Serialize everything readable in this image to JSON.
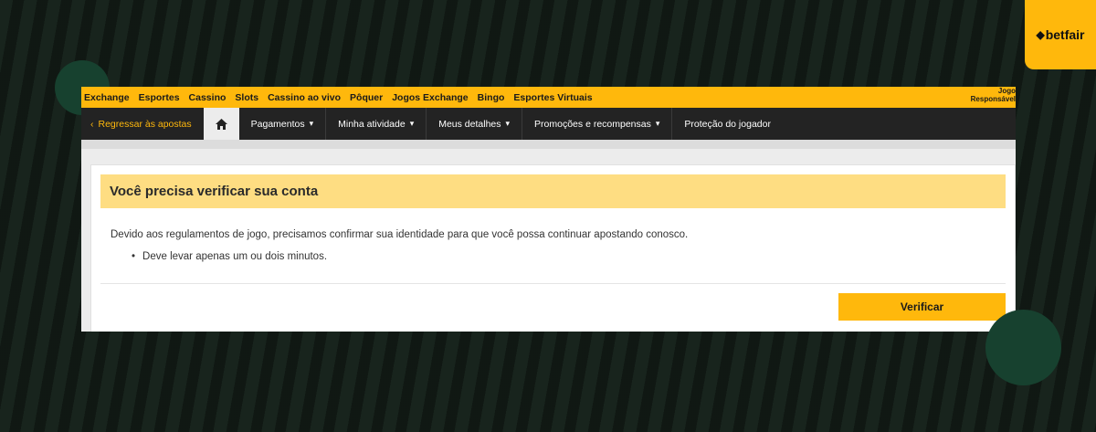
{
  "brand": {
    "name": "betfair",
    "color": "#ffb80c"
  },
  "topnav": {
    "links": [
      "Exchange",
      "Esportes",
      "Cassino",
      "Slots",
      "Cassino ao vivo",
      "Pôquer",
      "Jogos Exchange",
      "Bingo",
      "Esportes Virtuais"
    ],
    "responsible_line1": "Jogo",
    "responsible_line2": "Responsável"
  },
  "mainnav": {
    "back_label": "Regressar às apostas",
    "home_icon": "home-icon",
    "items": [
      {
        "label": "Pagamentos",
        "dropdown": true
      },
      {
        "label": "Minha atividade",
        "dropdown": true
      },
      {
        "label": "Meus detalhes",
        "dropdown": true
      },
      {
        "label": "Promoções e recompensas",
        "dropdown": true
      },
      {
        "label": "Proteção do jogador",
        "dropdown": false
      }
    ]
  },
  "notice": {
    "title": "Você precisa verificar sua conta",
    "body": "Devido aos regulamentos de jogo, precisamos confirmar sua identidade para que você possa continuar apostando conosco.",
    "bullet": "Deve levar apenas um ou dois minutos.",
    "button_label": "Verificar"
  }
}
